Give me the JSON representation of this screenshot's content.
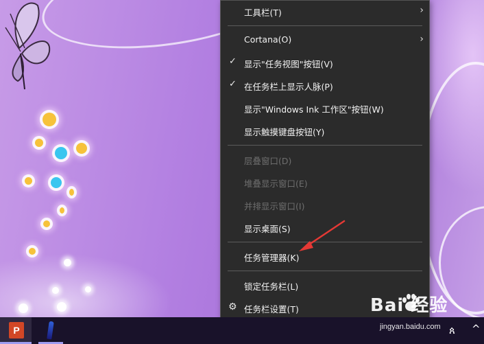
{
  "menu": {
    "items": [
      {
        "label": "工具栏(T)",
        "checked": false,
        "submenu": true,
        "enabled": true
      },
      {
        "label": "Cortana(O)",
        "checked": false,
        "submenu": true,
        "enabled": true
      },
      {
        "label": "显示\"任务视图\"按钮(V)",
        "checked": true,
        "submenu": false,
        "enabled": true
      },
      {
        "label": "在任务栏上显示人脉(P)",
        "checked": true,
        "submenu": false,
        "enabled": true
      },
      {
        "label": "显示\"Windows Ink 工作区\"按钮(W)",
        "checked": false,
        "submenu": false,
        "enabled": true
      },
      {
        "label": "显示触摸键盘按钮(Y)",
        "checked": false,
        "submenu": false,
        "enabled": true
      },
      {
        "label": "层叠窗口(D)",
        "checked": false,
        "submenu": false,
        "enabled": false
      },
      {
        "label": "堆叠显示窗口(E)",
        "checked": false,
        "submenu": false,
        "enabled": false
      },
      {
        "label": "并排显示窗口(I)",
        "checked": false,
        "submenu": false,
        "enabled": false
      },
      {
        "label": "显示桌面(S)",
        "checked": false,
        "submenu": false,
        "enabled": true
      },
      {
        "label": "任务管理器(K)",
        "checked": false,
        "submenu": false,
        "enabled": true
      },
      {
        "label": "锁定任务栏(L)",
        "checked": false,
        "submenu": false,
        "enabled": true
      },
      {
        "label": "任务栏设置(T)",
        "checked": false,
        "submenu": false,
        "enabled": true,
        "icon": "gear-icon"
      }
    ],
    "check_glyph": "✓",
    "arrow_glyph": "›"
  },
  "taskbar": {
    "apps": [
      {
        "name": "PowerPoint",
        "icon": "powerpoint-icon",
        "glyph": "P"
      },
      {
        "name": "Pen",
        "icon": "pen-icon"
      }
    ],
    "tray": {
      "people_glyph": "ጰ",
      "chevron_glyph": "^"
    }
  },
  "watermark": {
    "brand": "Bai  经验",
    "url": "jingyan.baidu.com"
  },
  "colors": {
    "menu_bg": "#2b2b2b",
    "menu_text": "#f2f2f2",
    "menu_disabled": "#6e6e6e",
    "taskbar_bg": "#19122a",
    "annotation_red": "#e53935",
    "wallpaper": "#b27fe1"
  }
}
